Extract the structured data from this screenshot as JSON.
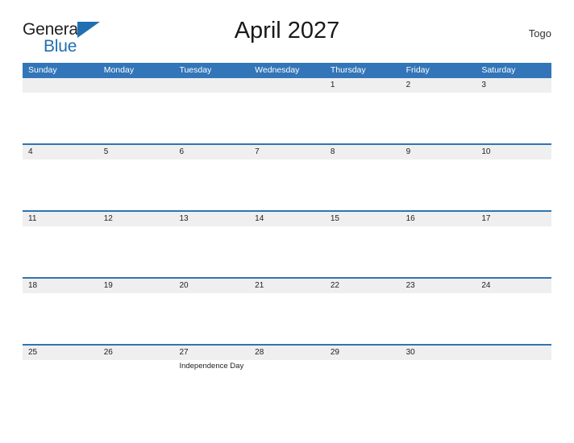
{
  "branding": {
    "logo_text_primary": "General",
    "logo_text_secondary": "Blue"
  },
  "header": {
    "title": "April 2027",
    "country": "Togo"
  },
  "calendar": {
    "weekday_headers": [
      "Sunday",
      "Monday",
      "Tuesday",
      "Wednesday",
      "Thursday",
      "Friday",
      "Saturday"
    ],
    "colors": {
      "header_blue": "#3275b8",
      "row_divider_blue": "#2f74b5",
      "number_band_gray": "#efefef",
      "logo_blue": "#1f6fb2"
    },
    "weeks": [
      [
        {
          "day": "",
          "events": []
        },
        {
          "day": "",
          "events": []
        },
        {
          "day": "",
          "events": []
        },
        {
          "day": "",
          "events": []
        },
        {
          "day": "1",
          "events": []
        },
        {
          "day": "2",
          "events": []
        },
        {
          "day": "3",
          "events": []
        }
      ],
      [
        {
          "day": "4",
          "events": []
        },
        {
          "day": "5",
          "events": []
        },
        {
          "day": "6",
          "events": []
        },
        {
          "day": "7",
          "events": []
        },
        {
          "day": "8",
          "events": []
        },
        {
          "day": "9",
          "events": []
        },
        {
          "day": "10",
          "events": []
        }
      ],
      [
        {
          "day": "11",
          "events": []
        },
        {
          "day": "12",
          "events": []
        },
        {
          "day": "13",
          "events": []
        },
        {
          "day": "14",
          "events": []
        },
        {
          "day": "15",
          "events": []
        },
        {
          "day": "16",
          "events": []
        },
        {
          "day": "17",
          "events": []
        }
      ],
      [
        {
          "day": "18",
          "events": []
        },
        {
          "day": "19",
          "events": []
        },
        {
          "day": "20",
          "events": []
        },
        {
          "day": "21",
          "events": []
        },
        {
          "day": "22",
          "events": []
        },
        {
          "day": "23",
          "events": []
        },
        {
          "day": "24",
          "events": []
        }
      ],
      [
        {
          "day": "25",
          "events": []
        },
        {
          "day": "26",
          "events": []
        },
        {
          "day": "27",
          "events": [
            "Independence Day"
          ]
        },
        {
          "day": "28",
          "events": []
        },
        {
          "day": "29",
          "events": []
        },
        {
          "day": "30",
          "events": []
        },
        {
          "day": "",
          "events": []
        }
      ]
    ]
  }
}
